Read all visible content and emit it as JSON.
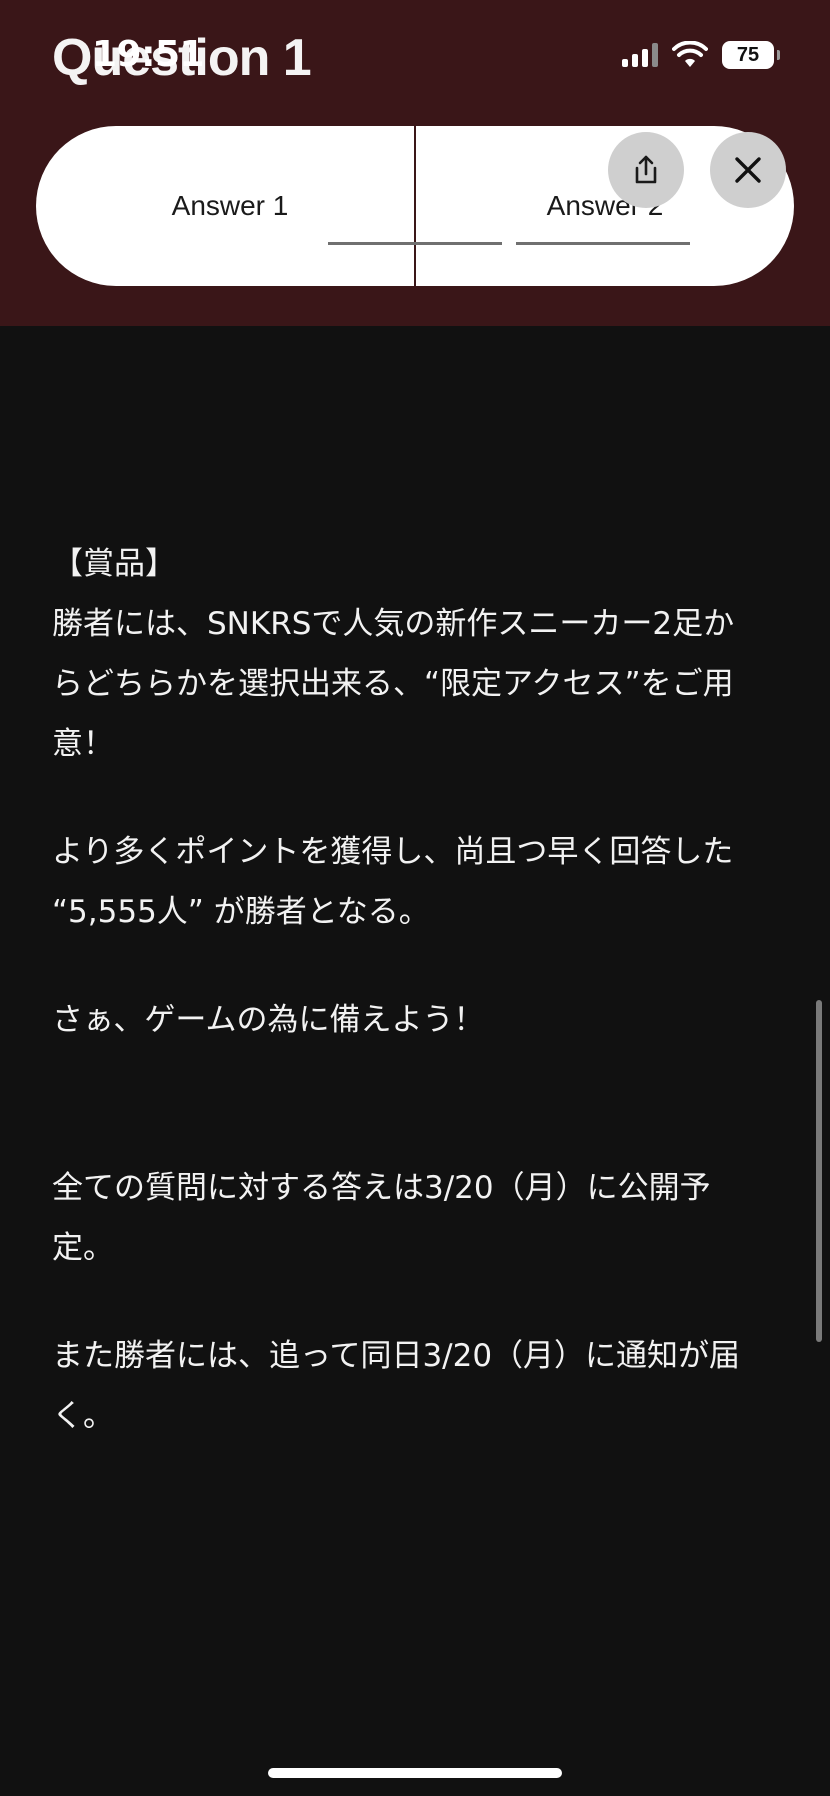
{
  "status_bar": {
    "time": "19:51",
    "battery": "75"
  },
  "header": {
    "title": "Question 1"
  },
  "answers": [
    {
      "label": "Answer 1"
    },
    {
      "label": "Answer 2"
    }
  ],
  "icons": {
    "share": "share-icon",
    "close": "close-icon",
    "signal": "cellular-signal-icon",
    "wifi": "wifi-icon",
    "battery": "battery-icon"
  },
  "content": {
    "prize_heading": "【賞品】",
    "prize_text": "勝者には、SNKRSで人気の新作スニーカー2足からどちらかを選択出来る、“限定アクセス”をご用意！",
    "winner_rule": "より多くポイントを獲得し、尚且つ早く回答した “5,555人” が勝者となる。",
    "call_to_action": "さぁ、ゲームの為に備えよう！",
    "answers_release": "全ての質問に対する答えは3/20（月）に公開予定。",
    "winner_notice": "また勝者には、追って同日3/20（月）に通知が届く。"
  },
  "colors": {
    "header_bg": "#3a1618",
    "body_bg": "#111111",
    "pill_bg": "#ffffff",
    "button_bg": "#cfcfcf"
  }
}
